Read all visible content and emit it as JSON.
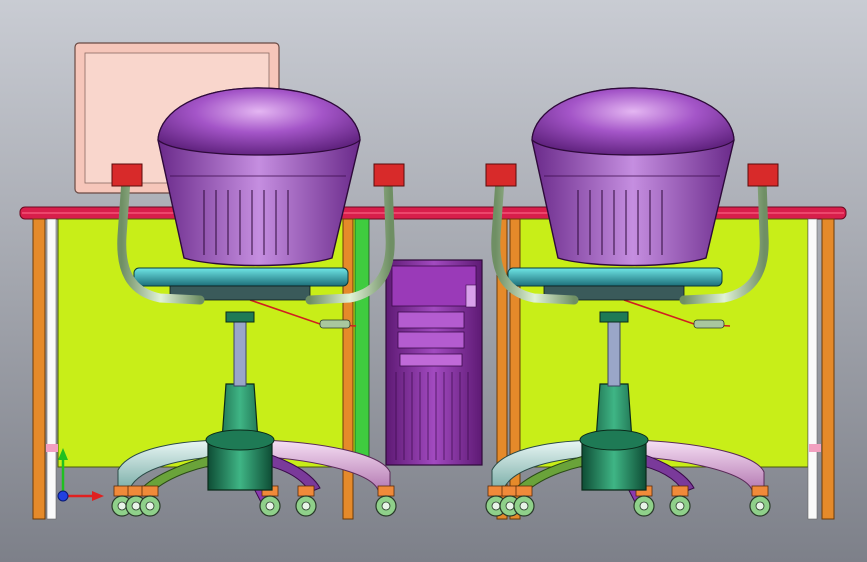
{
  "scene": {
    "kind": "cad-assembly-render",
    "objects": [
      "monitor",
      "desk",
      "computer-tower",
      "office-chair-left",
      "office-chair-right",
      "axis-triad"
    ]
  },
  "colors": {
    "background_top": "#c9ccd3",
    "background_bottom": "#7d8089",
    "desk_top": "#d81e4b",
    "desk_leg": "#e58a2a",
    "modesty_panel": "#c8ee18",
    "seat": "#8b3bb0",
    "seat_highlight": "#d49be8",
    "tower": "#8a2fa3",
    "monitor": "#f6c6ba",
    "chair_base": "#1e7a55",
    "chair_leg_light": "#b9d8d4",
    "chair_leg_pink": "#d9a6d8",
    "caster": "#f08a3a",
    "armrest": "#a9c79e",
    "axis_x": "#e02020",
    "axis_y": "#20c020",
    "axis_z": "#2040e0"
  }
}
